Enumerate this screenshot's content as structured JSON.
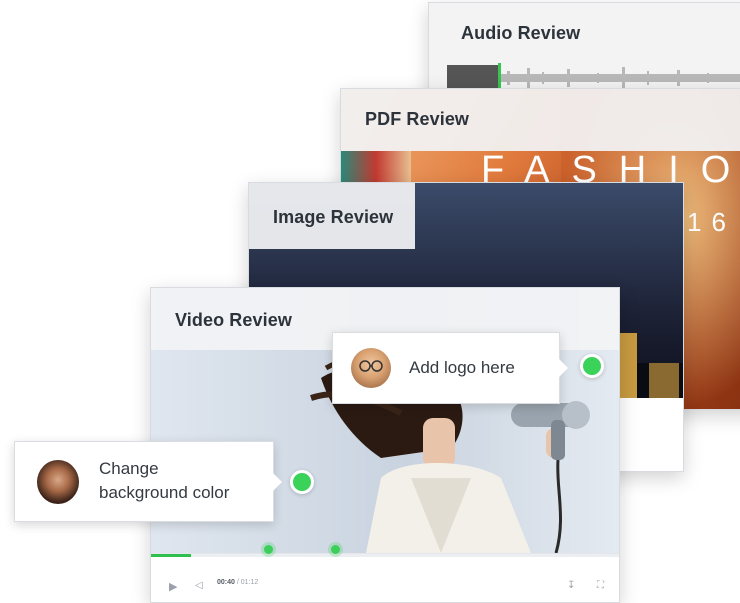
{
  "cards": {
    "audio": {
      "title": "Audio Review"
    },
    "pdf": {
      "title": "PDF Review",
      "cover_word": "FASHION",
      "cover_year": "16"
    },
    "image": {
      "title": "Image Review"
    },
    "video": {
      "title": "Video Review"
    }
  },
  "callouts": {
    "logo": {
      "text": "Add logo here",
      "avatar": "man-with-glasses-avatar"
    },
    "background": {
      "line1": "Change",
      "line2": "background color",
      "avatar": "woman-avatar"
    }
  },
  "player": {
    "current_time": "00:40",
    "separator_duration": "/ 01:12",
    "progress": 0.085,
    "comment_markers": [
      0.25,
      0.39
    ],
    "icons": [
      "play-icon",
      "volume-icon",
      "download-icon",
      "fullscreen-icon"
    ]
  },
  "colors": {
    "accent": "#3bd25a",
    "title_bar": "#f2f3f5",
    "title_text": "#2d333b"
  }
}
